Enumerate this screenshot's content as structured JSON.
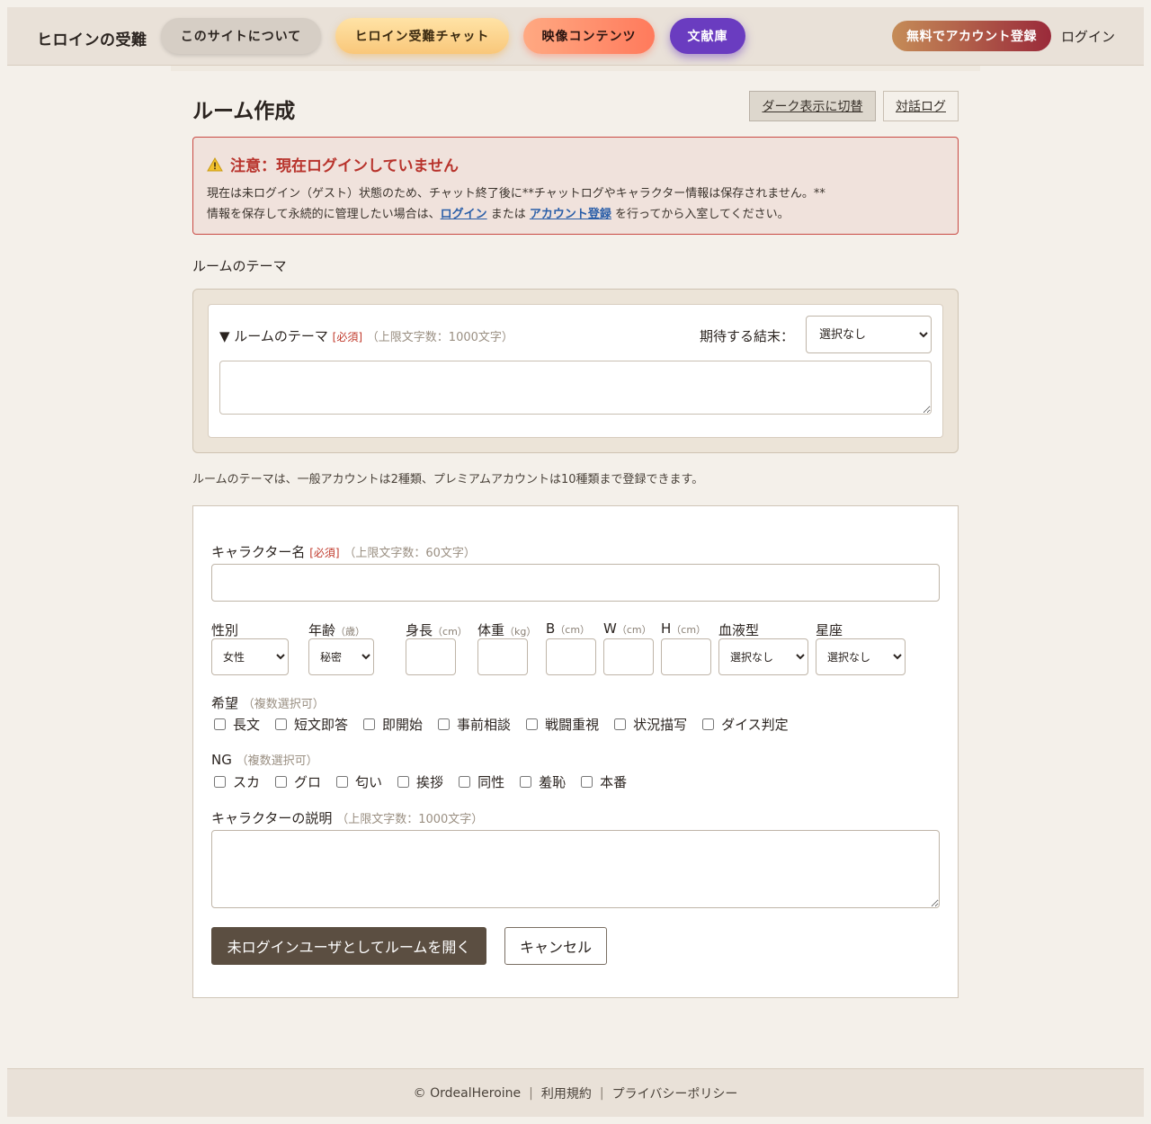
{
  "header": {
    "brand": "ヒロインの受難",
    "nav": {
      "about": "このサイトについて",
      "chat": "ヒロイン受難チャット",
      "video": "映像コンテンツ",
      "library": "文献庫"
    },
    "register": "無料でアカウント登録",
    "login": "ログイン"
  },
  "main": {
    "title": "ルーム作成",
    "dark_toggle": "ダーク表示に切替",
    "chat_log": "対話ログ"
  },
  "alert": {
    "title": "注意：現在ログインしていません",
    "line1": "現在は未ログイン（ゲスト）状態のため、チャット終了後に**チャットログやキャラクター情報は保存されません。**",
    "line2_pre": "情報を保存して永続的に管理したい場合は、",
    "login_link": "ログイン",
    "line2_mid": " または ",
    "register_link": "アカウント登録",
    "line2_post": " を行ってから入室してください。"
  },
  "theme": {
    "section_label": "ルームのテーマ",
    "heading": "▼ ルームのテーマ",
    "required": "[必須]",
    "limit": "（上限文字数：1000文字）",
    "ending_label": "期待する結末：",
    "ending_value": "選択なし",
    "note": "ルームのテーマは、一般アカウントは2種類、プレミアムアカウントは10種類まで登録できます。"
  },
  "character": {
    "name_label": "キャラクター名",
    "required": "[必須]",
    "name_limit": "（上限文字数：60文字）",
    "gender_label": "性別",
    "gender_value": "女性",
    "age_label": "年齢",
    "age_unit": "（歳）",
    "age_value": "秘密",
    "height_label": "身長",
    "height_unit": "（cm）",
    "weight_label": "体重",
    "weight_unit": "（kg）",
    "b_label": "B",
    "w_label": "W",
    "h_label": "H",
    "cm_unit": "（cm）",
    "blood_label": "血液型",
    "blood_value": "選択なし",
    "zodiac_label": "星座",
    "zodiac_value": "選択なし",
    "wish_label": "希望",
    "wish_hint": "（複数選択可）",
    "wish_options": [
      "長文",
      "短文即答",
      "即開始",
      "事前相談",
      "戦闘重視",
      "状況描写",
      "ダイス判定"
    ],
    "ng_label": "NG",
    "ng_hint": "（複数選択可）",
    "ng_options": [
      "スカ",
      "グロ",
      "匂い",
      "挨拶",
      "同性",
      "羞恥",
      "本番"
    ],
    "desc_label": "キャラクターの説明",
    "desc_limit": "（上限文字数：1000文字）",
    "open_button": "未ログインユーザとしてルームを開く",
    "cancel_button": "キャンセル"
  },
  "footer": {
    "copyright": "© OrdealHeroine",
    "terms": "利用規約",
    "privacy": "プライバシーポリシー",
    "separator": "|"
  }
}
